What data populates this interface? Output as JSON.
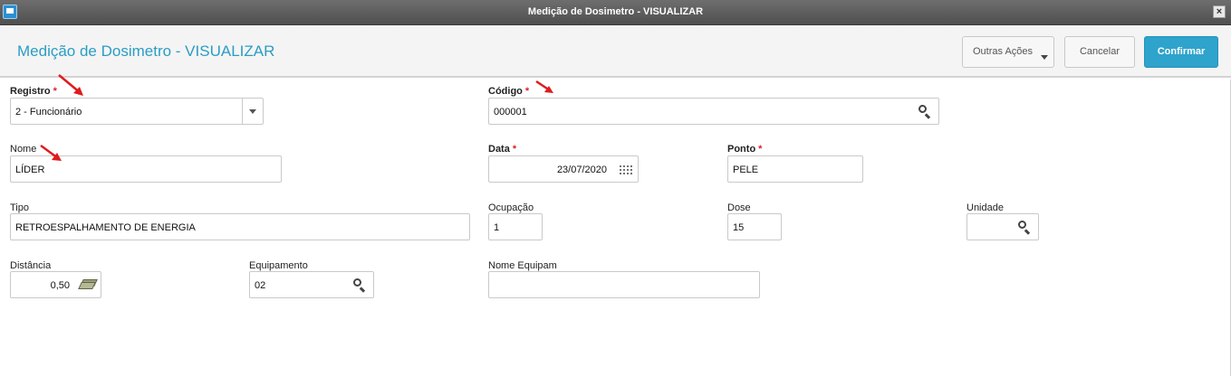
{
  "window": {
    "title": "Medição de Dosimetro - VISUALIZAR"
  },
  "header": {
    "page_title": "Medição de Dosimetro - VISUALIZAR",
    "more_actions_label": "Outras Ações",
    "cancel_label": "Cancelar",
    "confirm_label": "Confirmar"
  },
  "form": {
    "registro": {
      "label": "Registro",
      "required_mark": "*",
      "value": "2 - Funcionário"
    },
    "codigo": {
      "label": "Código",
      "required_mark": "*",
      "value": "000001"
    },
    "nome": {
      "label": "Nome",
      "value": "LÍDER"
    },
    "data": {
      "label": "Data",
      "required_mark": "*",
      "value": "23/07/2020"
    },
    "ponto": {
      "label": "Ponto",
      "required_mark": "*",
      "value": "PELE"
    },
    "tipo": {
      "label": "Tipo",
      "value": "RETROESPALHAMENTO DE ENERGIA"
    },
    "ocupacao": {
      "label": "Ocupação",
      "value": "1"
    },
    "dose": {
      "label": "Dose",
      "value": "15"
    },
    "unidade": {
      "label": "Unidade",
      "value": ""
    },
    "distancia": {
      "label": "Distância",
      "value": "0,50"
    },
    "equipamento": {
      "label": "Equipamento",
      "value": "02"
    },
    "nome_equipam": {
      "label": "Nome Equipam",
      "value": ""
    }
  },
  "colors": {
    "accent": "#2a9dc4",
    "confirm_button": "#2ea3cc",
    "required_star": "#d9222a",
    "annotation_arrow": "#e01b1b"
  },
  "icons": [
    "app-icon",
    "close-icon",
    "chevron-down-icon",
    "search-icon",
    "calendar-icon",
    "money-icon"
  ]
}
